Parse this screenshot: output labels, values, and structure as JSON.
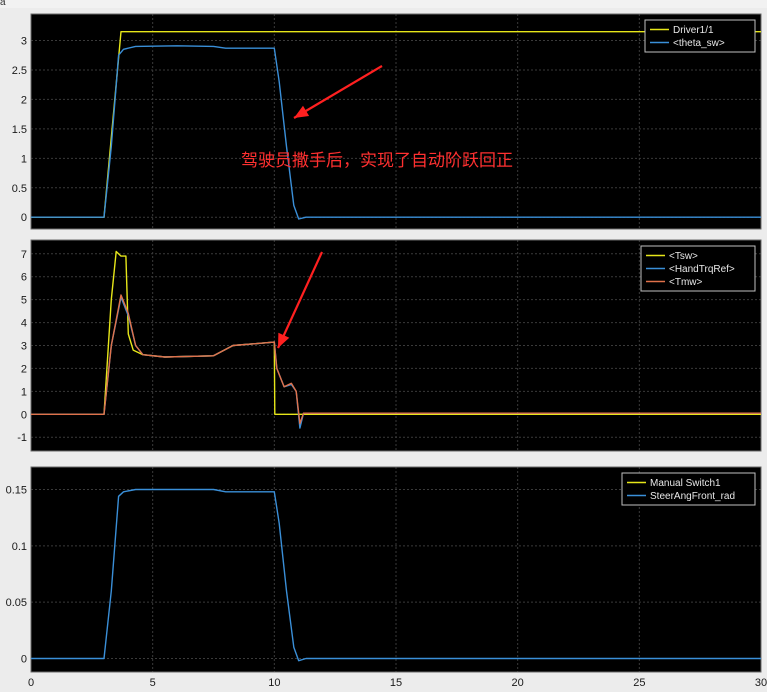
{
  "window": {
    "top_label": "a"
  },
  "colors": {
    "yellow": "#e6e619",
    "blue": "#3a8fd8",
    "orange": "#e0714a",
    "red": "#ff2020"
  },
  "chart_data": [
    {
      "type": "line",
      "xlim": [
        0,
        30
      ],
      "ylim": [
        -0.2,
        3.45
      ],
      "yticks": [
        0,
        0.5,
        1,
        1.5,
        2,
        2.5,
        3
      ],
      "ytick_labels": [
        "0",
        "0.5",
        "1",
        "1.5",
        "2",
        "2.5",
        "3"
      ],
      "xticks": [
        0,
        5,
        10,
        15,
        20,
        25,
        30
      ],
      "grid": true,
      "legend_position": "top-right",
      "series": [
        {
          "name": "Driver1/1",
          "color": "#e6e619",
          "x": [
            0,
            3,
            3.7,
            30
          ],
          "y": [
            0,
            0,
            3.15,
            3.15
          ]
        },
        {
          "name": "<theta_sw>",
          "color": "#3a8fd8",
          "x": [
            0,
            3,
            3.3,
            3.6,
            3.8,
            4.3,
            6,
            7.5,
            8,
            10,
            10.2,
            10.5,
            10.8,
            11,
            11.3,
            30
          ],
          "y": [
            0,
            0,
            1.2,
            2.75,
            2.85,
            2.9,
            2.91,
            2.9,
            2.87,
            2.87,
            2.3,
            1.2,
            0.2,
            -0.03,
            0,
            0
          ]
        }
      ],
      "annotation": "驾驶员撒手后，实现了自动阶跃回正"
    },
    {
      "type": "line",
      "xlim": [
        0,
        30
      ],
      "ylim": [
        -1.6,
        7.6
      ],
      "yticks": [
        -1,
        0,
        1,
        2,
        3,
        4,
        5,
        6,
        7
      ],
      "ytick_labels": [
        "-1",
        "0",
        "1",
        "2",
        "3",
        "4",
        "5",
        "6",
        "7"
      ],
      "xticks": [
        0,
        5,
        10,
        15,
        20,
        25,
        30
      ],
      "grid": true,
      "legend_position": "top-right",
      "series": [
        {
          "name": "<Tsw>",
          "color": "#e6e619",
          "x": [
            0,
            3,
            3.3,
            3.5,
            3.7,
            3.9,
            4,
            4.2,
            4.6,
            5.5,
            7.5,
            8.3,
            10,
            10.02,
            30
          ],
          "y": [
            0,
            0,
            5,
            7.1,
            6.9,
            6.9,
            3.5,
            2.8,
            2.6,
            2.5,
            2.55,
            3,
            3.15,
            0,
            0
          ]
        },
        {
          "name": "<HandTrqRef>",
          "color": "#3a8fd8",
          "x": [
            0,
            3,
            3.3,
            3.7,
            4,
            4.3,
            4.6,
            5.5,
            7.5,
            8.3,
            10,
            10.1,
            10.4,
            10.7,
            10.9,
            11.05,
            11.2,
            30
          ],
          "y": [
            0,
            0,
            3,
            5.1,
            4.3,
            3,
            2.6,
            2.5,
            2.55,
            3,
            3.15,
            2,
            1.2,
            1.3,
            1,
            -0.6,
            0.05,
            0.05
          ]
        },
        {
          "name": "<Tmw>",
          "color": "#e0714a",
          "x": [
            0,
            3,
            3.3,
            3.7,
            4,
            4.3,
            4.6,
            5.5,
            7.5,
            8.3,
            10,
            10.1,
            10.4,
            10.7,
            10.9,
            11.05,
            11.2,
            30
          ],
          "y": [
            0,
            0,
            3,
            5.2,
            4.4,
            3,
            2.6,
            2.5,
            2.55,
            3,
            3.15,
            2,
            1.2,
            1.35,
            1,
            -0.4,
            0.05,
            0.05
          ]
        }
      ]
    },
    {
      "type": "line",
      "xlim": [
        0,
        30
      ],
      "ylim": [
        -0.012,
        0.17
      ],
      "yticks": [
        0,
        0.05,
        0.1,
        0.15
      ],
      "ytick_labels": [
        "0",
        "0.05",
        "0.1",
        "0.15"
      ],
      "xticks": [
        0,
        5,
        10,
        15,
        20,
        25,
        30
      ],
      "xtick_labels": [
        "0",
        "5",
        "10",
        "15",
        "20",
        "25",
        "30"
      ],
      "grid": true,
      "legend_position": "top-right",
      "series": [
        {
          "name": "Manual Switch1",
          "color": "#e6e619",
          "x": [],
          "y": []
        },
        {
          "name": "SteerAngFront_rad",
          "color": "#3a8fd8",
          "x": [
            0,
            3,
            3.3,
            3.6,
            3.8,
            4.3,
            6,
            7.5,
            8,
            10,
            10.2,
            10.5,
            10.8,
            11,
            11.3,
            30
          ],
          "y": [
            0,
            0,
            0.06,
            0.144,
            0.148,
            0.15,
            0.15,
            0.15,
            0.148,
            0.148,
            0.12,
            0.06,
            0.01,
            -0.002,
            0,
            0
          ]
        }
      ]
    }
  ]
}
